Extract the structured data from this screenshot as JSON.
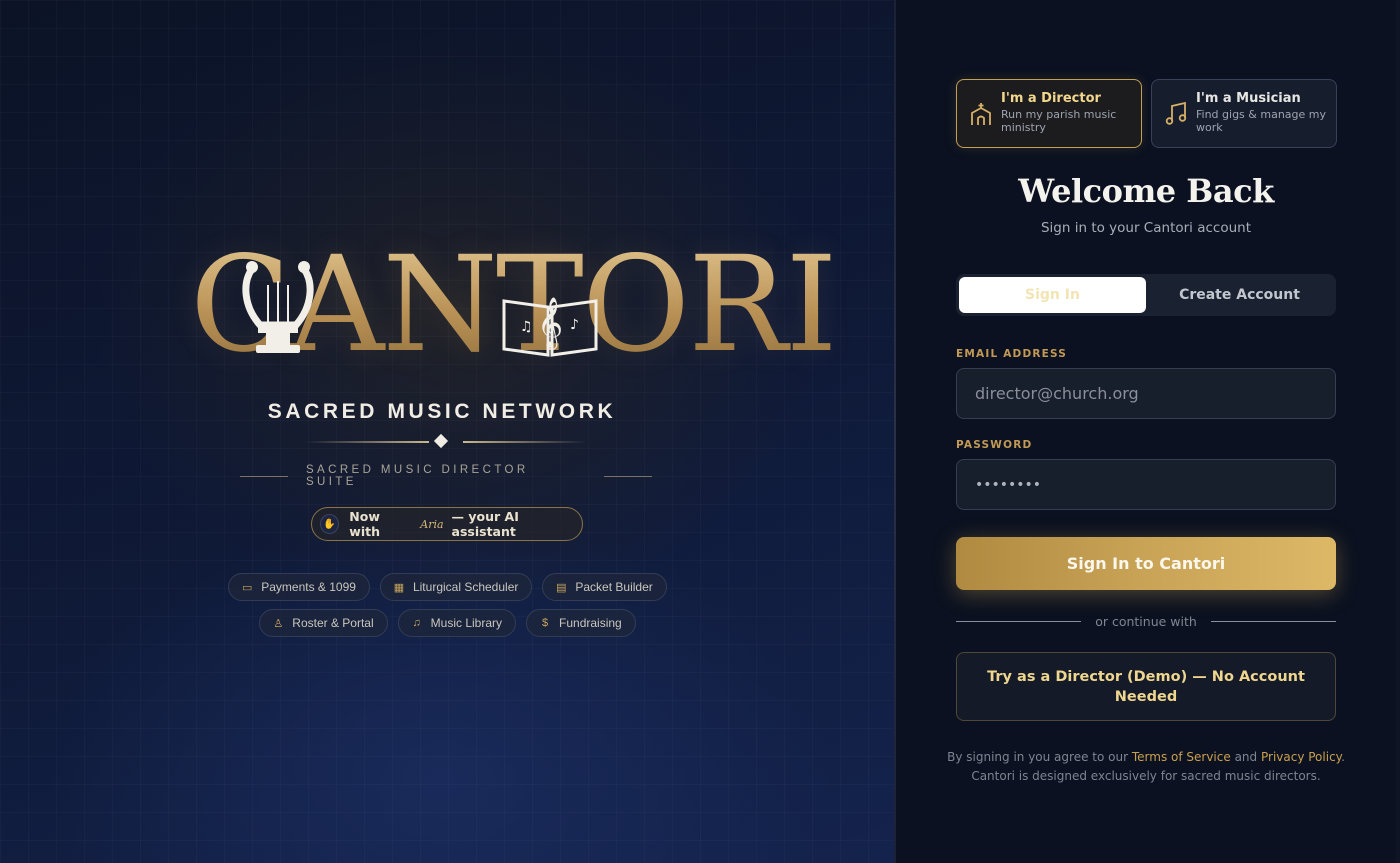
{
  "brand": {
    "logo_text": "CANTORI",
    "tagline": "SACRED MUSIC NETWORK",
    "suite": "SACRED MUSIC DIRECTOR SUITE",
    "colors": {
      "gold": "#c9a356",
      "navy": "#0b1120",
      "accent_text": "#efd68f"
    }
  },
  "aria": {
    "prefix": "Now with",
    "name": "Aria",
    "suffix": "— your AI assistant",
    "icon": "hand-icon"
  },
  "features": [
    {
      "label": "Payments & 1099",
      "icon": "card-icon"
    },
    {
      "label": "Liturgical Scheduler",
      "icon": "calendar-icon"
    },
    {
      "label": "Packet Builder",
      "icon": "archive-icon"
    },
    {
      "label": "Roster & Portal",
      "icon": "person-icon"
    },
    {
      "label": "Music Library",
      "icon": "music-note-icon"
    },
    {
      "label": "Fundraising",
      "icon": "dollar-icon"
    }
  ],
  "roles": {
    "director": {
      "title": "I'm a Director",
      "subtitle": "Run my parish music ministry",
      "icon": "church-icon"
    },
    "musician": {
      "title": "I'm a Musician",
      "subtitle": "Find gigs & manage my work",
      "icon": "music-note-icon"
    }
  },
  "auth": {
    "title": "Welcome Back",
    "subtitle": "Sign in to your Cantori account",
    "tabs": {
      "signin": "Sign In",
      "create": "Create Account"
    },
    "email_label": "EMAIL ADDRESS",
    "email_placeholder": "director@church.org",
    "password_label": "PASSWORD",
    "password_value": "••••••••",
    "submit": "Sign In to Cantori",
    "or_text": "or continue with",
    "demo": "Try as a Director (Demo) — No Account Needed",
    "legal": {
      "prefix": "By signing in you agree to our",
      "terms": "Terms of Service",
      "and": "and",
      "privacy": "Privacy Policy",
      "period": ".",
      "line2": "Cantori is designed exclusively for sacred music directors."
    }
  }
}
